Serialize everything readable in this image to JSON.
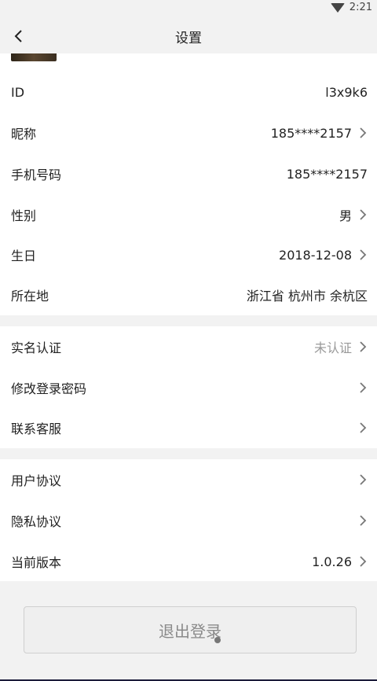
{
  "status": {
    "time": "2:21",
    "wifi_icon": "wifi-icon"
  },
  "nav": {
    "title": "设置",
    "back_icon": "chevron-left-icon"
  },
  "profile": [
    {
      "label": "ID",
      "value": "l3x9k6",
      "chevron": false
    },
    {
      "label": "昵称",
      "value": "185****2157",
      "chevron": true
    },
    {
      "label": "手机号码",
      "value": "185****2157",
      "chevron": false
    },
    {
      "label": "性别",
      "value": "男",
      "chevron": true
    },
    {
      "label": "生日",
      "value": "2018-12-08",
      "chevron": true
    },
    {
      "label": "所在地",
      "value": "浙江省 杭州市 余杭区",
      "chevron": false
    }
  ],
  "security": [
    {
      "label": "实名认证",
      "value": "未认证",
      "chevron": true
    },
    {
      "label": "修改登录密码",
      "value": "",
      "chevron": true
    },
    {
      "label": "联系客服",
      "value": "",
      "chevron": true
    }
  ],
  "about": [
    {
      "label": "用户协议",
      "value": "",
      "chevron": true
    },
    {
      "label": "隐私协议",
      "value": "",
      "chevron": true
    },
    {
      "label": "当前版本",
      "value": "1.0.26",
      "chevron": true
    }
  ],
  "logout": {
    "label": "退出登录"
  },
  "colors": {
    "background": "#f2f2f2",
    "card": "#ffffff",
    "muted_text": "#999999"
  }
}
